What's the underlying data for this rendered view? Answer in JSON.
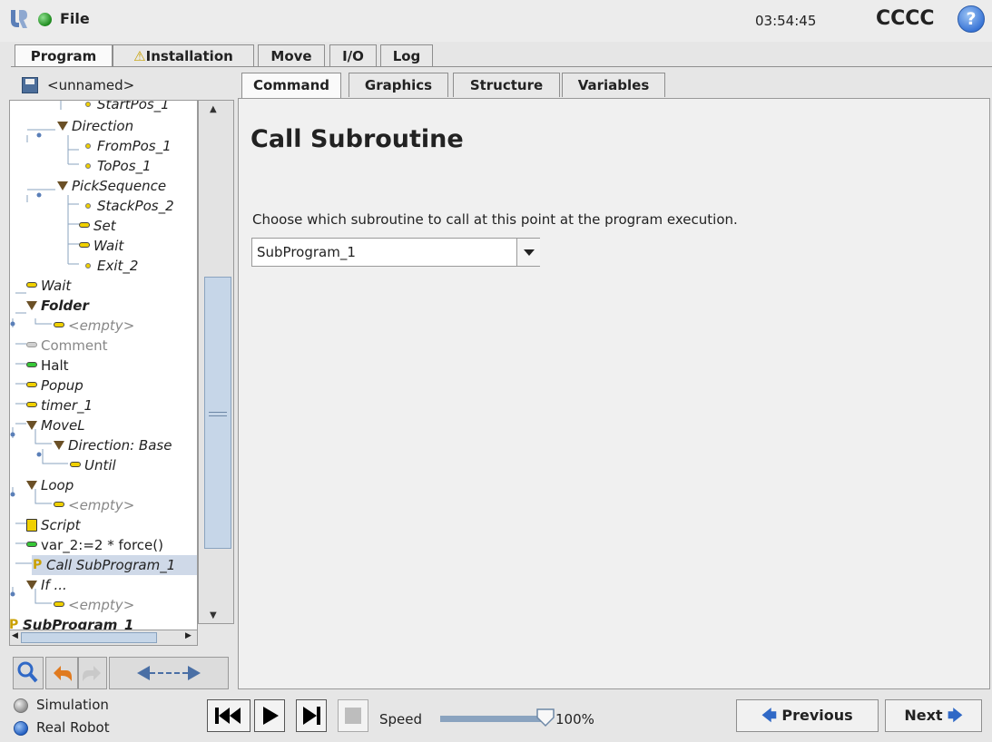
{
  "header": {
    "file_label": "File",
    "time": "03:54:45",
    "robot_name": "CCCC",
    "help_label": "?"
  },
  "main_tabs": [
    {
      "label": "Program",
      "active": true
    },
    {
      "label": "Installation",
      "warning": true
    },
    {
      "label": "Move"
    },
    {
      "label": "I/O"
    },
    {
      "label": "Log"
    }
  ],
  "file": {
    "name": "<unnamed>"
  },
  "tree": [
    {
      "label": "StartPos_1",
      "style": "italic",
      "icon": "waypoint"
    },
    {
      "label": "Direction",
      "style": "italic",
      "icon": "folder-triangle"
    },
    {
      "label": "FromPos_1",
      "style": "italic",
      "icon": "waypoint"
    },
    {
      "label": "ToPos_1",
      "style": "italic",
      "icon": "waypoint"
    },
    {
      "label": "PickSequence",
      "style": "italic",
      "icon": "folder-triangle"
    },
    {
      "label": "StackPos_2",
      "style": "italic",
      "icon": "waypoint"
    },
    {
      "label": "Set",
      "style": "italic",
      "icon": "command"
    },
    {
      "label": "Wait",
      "style": "italic",
      "icon": "command"
    },
    {
      "label": "Exit_2",
      "style": "italic",
      "icon": "waypoint"
    },
    {
      "label": "Wait",
      "style": "italic",
      "icon": "command"
    },
    {
      "label": "Folder",
      "style": "bold-italic",
      "icon": "folder-triangle"
    },
    {
      "label": "<empty>",
      "style": "gray-italic",
      "icon": "command"
    },
    {
      "label": "Comment",
      "style": "gray",
      "icon": "command"
    },
    {
      "label": "Halt",
      "style": "normal",
      "icon": "command"
    },
    {
      "label": "Popup",
      "style": "italic",
      "icon": "command"
    },
    {
      "label": "timer_1",
      "style": "italic",
      "icon": "command"
    },
    {
      "label": "MoveL",
      "style": "italic",
      "icon": "folder-triangle"
    },
    {
      "label": "Direction: Base",
      "style": "italic",
      "icon": "folder-triangle"
    },
    {
      "label": "Until",
      "style": "italic",
      "icon": "command"
    },
    {
      "label": "Loop",
      "style": "italic",
      "icon": "folder-triangle"
    },
    {
      "label": "<empty>",
      "style": "gray-italic",
      "icon": "command"
    },
    {
      "label": "Script",
      "style": "italic",
      "icon": "script"
    },
    {
      "label": "var_2:=2 * force()",
      "style": "normal",
      "icon": "command"
    },
    {
      "label": "Call SubProgram_1",
      "style": "italic",
      "icon": "call",
      "selected": true
    },
    {
      "label": "If ...",
      "style": "italic",
      "icon": "folder-triangle"
    },
    {
      "label": "<empty>",
      "style": "gray-italic",
      "icon": "command"
    },
    {
      "label": "SubProgram_1",
      "style": "bold-italic",
      "icon": "call"
    }
  ],
  "sub_tabs": [
    {
      "label": "Command",
      "active": true
    },
    {
      "label": "Graphics"
    },
    {
      "label": "Structure"
    },
    {
      "label": "Variables"
    }
  ],
  "command": {
    "title": "Call Subroutine",
    "description": "Choose which subroutine to call at this point at the program execution.",
    "selected_subroutine": "SubProgram_1"
  },
  "footer": {
    "simulation_label": "Simulation",
    "real_robot_label": "Real Robot",
    "speed_label": "Speed",
    "speed_value": "100%",
    "speed_fraction": 1.0,
    "previous_label": "Previous",
    "next_label": "Next"
  }
}
